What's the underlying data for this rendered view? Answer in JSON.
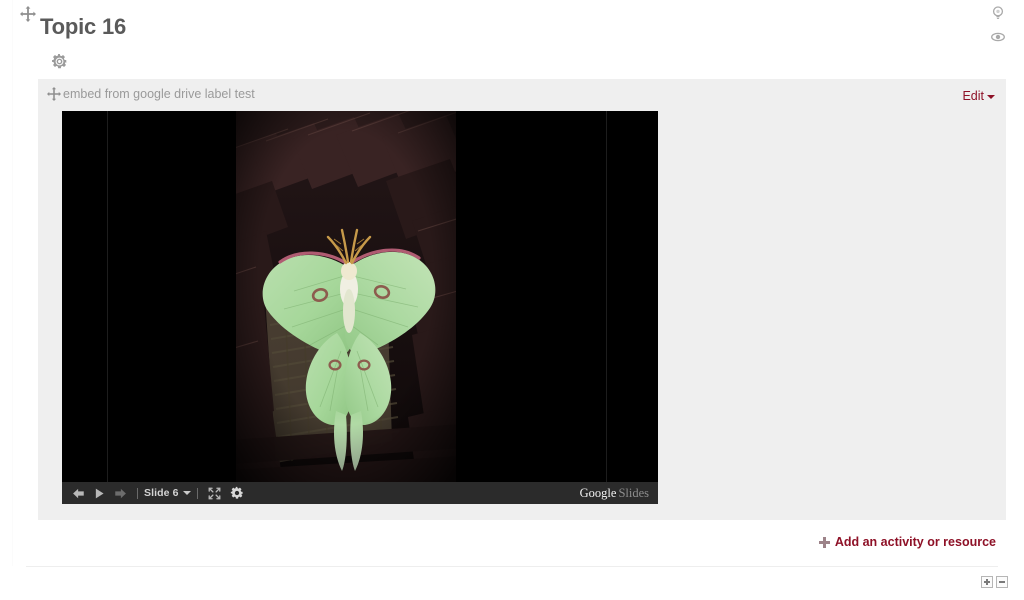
{
  "topic": {
    "title": "Topic 16",
    "move_handle_icon": "move-crosshair-icon",
    "settings_icon": "gear-icon"
  },
  "topic_controls": [
    {
      "name": "highlight-topic",
      "icon": "lightbulb-icon"
    },
    {
      "name": "hide-topic",
      "icon": "eye-icon"
    }
  ],
  "activity": {
    "move_handle_icon": "move-crosshair-icon",
    "label": "embed from google drive label test",
    "edit_menu_label": "Edit"
  },
  "player": {
    "prev_icon": "arrow-left-icon",
    "play_icon": "play-icon",
    "next_icon": "arrow-right-icon",
    "slide_label": "Slide 6",
    "fullscreen_icon": "fullscreen-icon",
    "settings_icon": "gear-icon",
    "brand_primary": "Google",
    "brand_secondary": "Slides"
  },
  "slide_content": {
    "description": "Photograph of a pale green luna moth resting on dark woven wicker furniture",
    "background_color": "#000000"
  },
  "footer": {
    "add_activity_label": "Add an activity or resource",
    "add_icon": "plus-icon",
    "expand_all_icon": "plus-box-icon",
    "collapse_all_icon": "minus-box-icon"
  },
  "colors": {
    "accent_red": "#8e1127",
    "block_background": "#efefef",
    "title_grey": "#5a5a5a",
    "label_grey": "#9a9a9a",
    "player_bar": "#2b2b2b"
  }
}
